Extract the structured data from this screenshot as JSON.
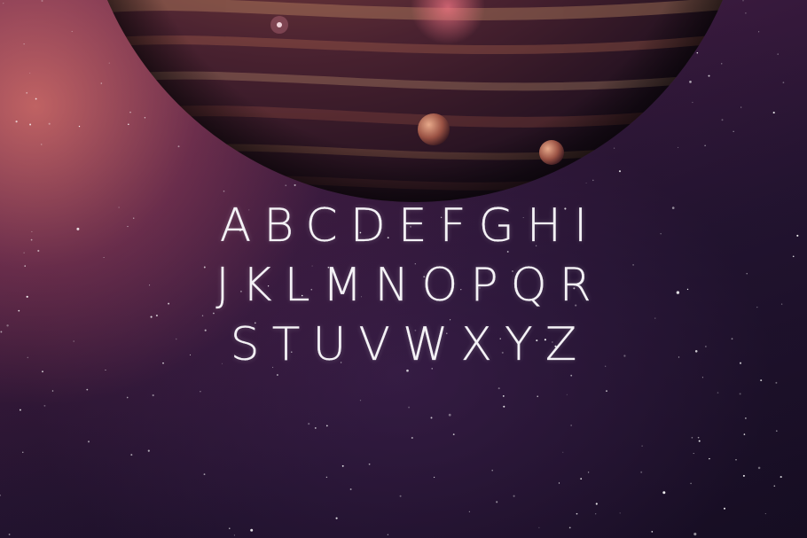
{
  "alphabet": {
    "row1": "ABCDEFGHI",
    "row2": "JKLMNOPQR",
    "row3": "STUVWXYZ"
  },
  "colors": {
    "text": "#f4f2f6",
    "space_dark": "#140c20",
    "space_glow": "#e8786e",
    "planet_base": "#7a3e3e",
    "planet_band": "#c8905a"
  }
}
